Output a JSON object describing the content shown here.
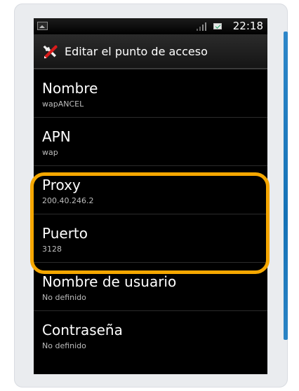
{
  "status_bar": {
    "time": "22:18"
  },
  "title_bar": {
    "title": "Editar el punto de acceso",
    "icon": "tools-icon"
  },
  "settings": [
    {
      "label": "Nombre",
      "value": "wapANCEL"
    },
    {
      "label": "APN",
      "value": "wap"
    },
    {
      "label": "Proxy",
      "value": "200.40.246.2"
    },
    {
      "label": "Puerto",
      "value": "3128"
    },
    {
      "label": "Nombre de usuario",
      "value": "No definido"
    },
    {
      "label": "Contraseña",
      "value": "No definido"
    }
  ],
  "colors": {
    "highlight": "#f5a700",
    "frame_accent": "#1572b6",
    "screen_background": "#000000"
  }
}
